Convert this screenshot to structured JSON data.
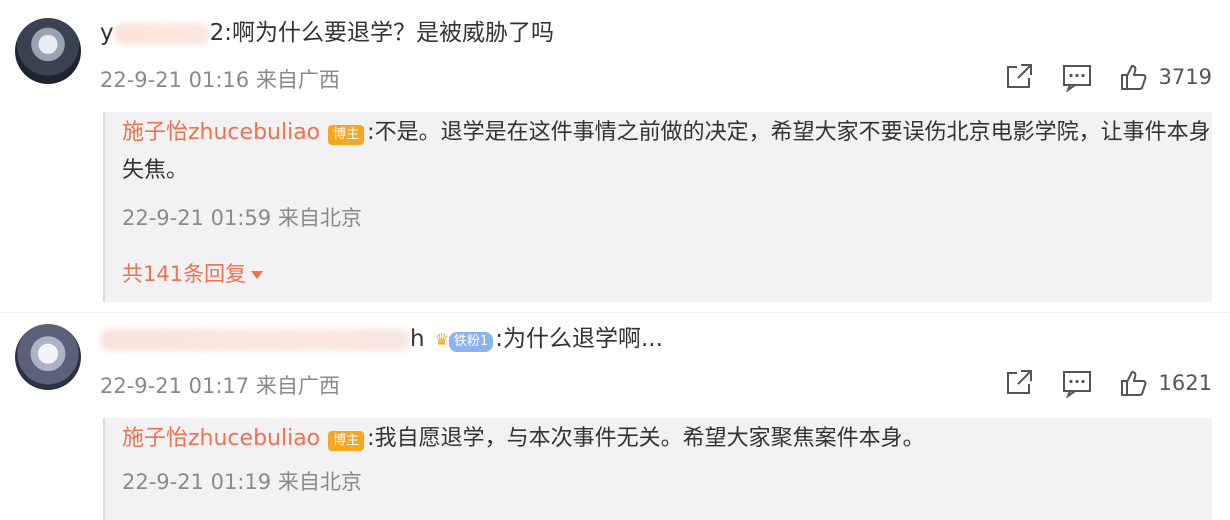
{
  "comments": [
    {
      "user_prefix": "y",
      "user_suffix": "2",
      "text": ":啊为什么要退学？是被威胁了吗",
      "time": "22-9-21 01:16 来自广西",
      "likes": "3719",
      "reply": {
        "author": "施子怡zhucebuliao",
        "badge": "博主",
        "text": ":不是。退学是在这件事情之前做的决定，希望大家不要误伤北京电影学院，让事件本身失焦。",
        "time": "22-9-21 01:59 来自北京",
        "more": "共141条回复"
      }
    },
    {
      "user_suffix": "h",
      "fan_badge": "铁粉1",
      "text": ":为什么退学啊...",
      "time": "22-9-21 01:17 来自广西",
      "likes": "1621",
      "reply": {
        "author": "施子怡zhucebuliao",
        "badge": "博主",
        "text": ":我自愿退学，与本次事件无关。希望大家聚焦案件本身。",
        "time": "22-9-21 01:19 来自北京"
      }
    }
  ],
  "icons": {
    "share": "share-icon",
    "comment": "comment-icon",
    "like": "thumbs-up-icon"
  },
  "colors": {
    "author": "#eb7350",
    "badge": "#f5a623",
    "meta": "#8a8a8a",
    "reply_bg": "#f2f2f5"
  }
}
